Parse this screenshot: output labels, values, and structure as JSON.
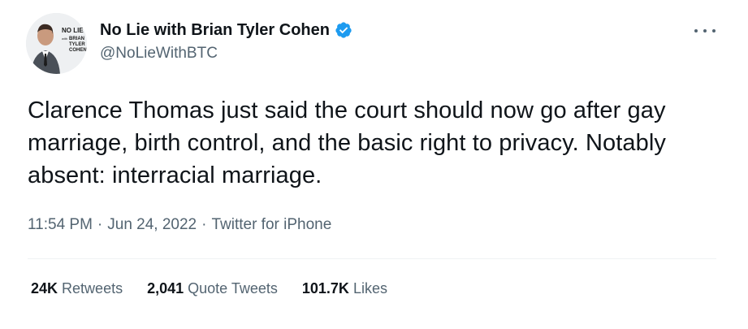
{
  "author": {
    "display_name": "No Lie with Brian Tyler Cohen",
    "handle": "@NoLieWithBTC",
    "avatar_text": [
      "NO LIE",
      "with",
      "BRIAN",
      "TYLER",
      "COHEN"
    ],
    "verified_color": "#1d9bf0"
  },
  "tweet": {
    "text": "Clarence Thomas just said the court should now go after gay marriage, birth control, and the basic right to privacy. Notably absent: interracial marriage.",
    "time": "11:54 PM",
    "date": "Jun 24, 2022",
    "source": "Twitter for iPhone",
    "separator": "·"
  },
  "stats": {
    "retweets_count": "24K",
    "retweets_label": "Retweets",
    "quotes_count": "2,041",
    "quotes_label": "Quote Tweets",
    "likes_count": "101.7K",
    "likes_label": "Likes"
  },
  "icons": {
    "verified": "verified-badge-icon",
    "more": "more-options-icon"
  }
}
